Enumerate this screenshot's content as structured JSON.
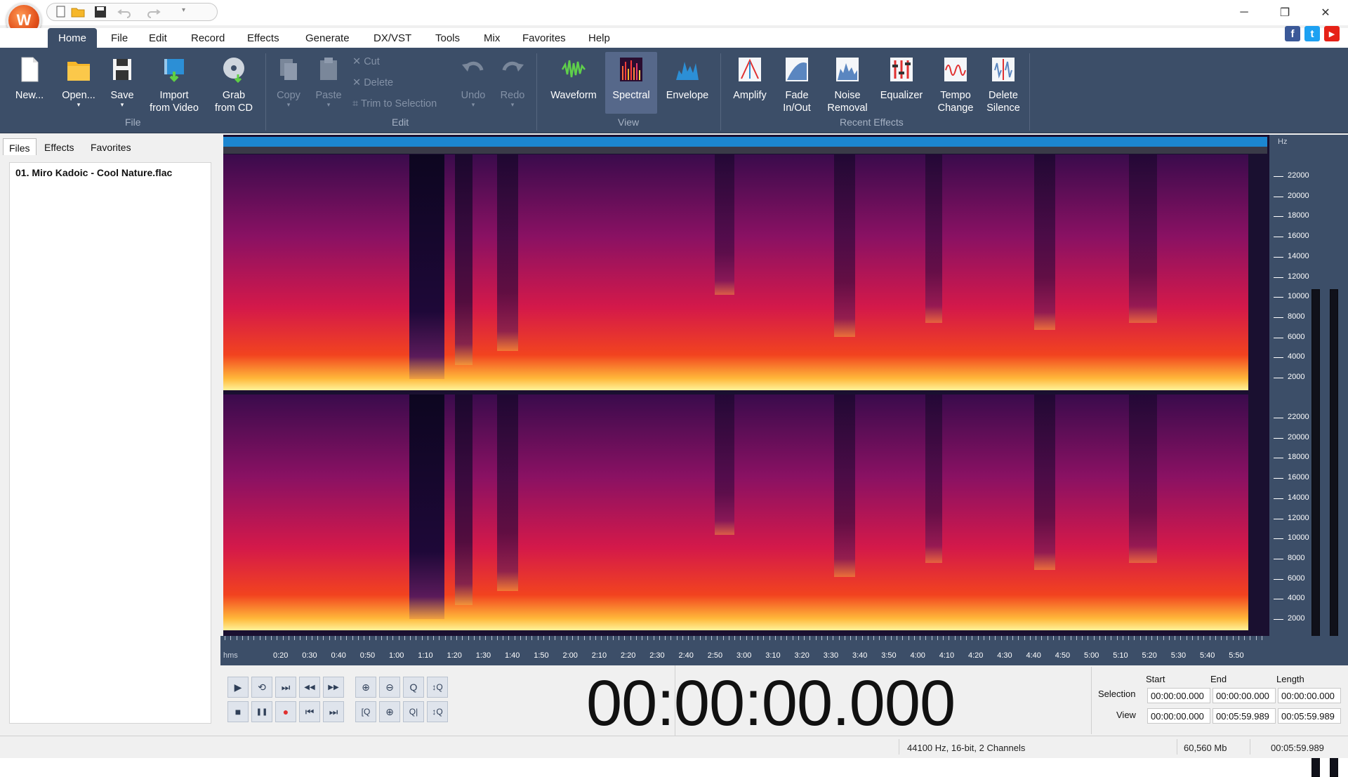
{
  "app": {
    "logo_letter": "W",
    "window_controls": {
      "minimize": "─",
      "restore": "❐",
      "close": "✕"
    },
    "social": {
      "facebook": "f",
      "twitter": "t",
      "youtube": "▶"
    }
  },
  "menu": {
    "items": [
      "Home",
      "File",
      "Edit",
      "Record",
      "Effects",
      "Generate",
      "DX/VST",
      "Tools",
      "Mix",
      "Favorites",
      "Help"
    ],
    "active": "Home"
  },
  "ribbon": {
    "file": {
      "new": "New...",
      "open": "Open...",
      "save": "Save",
      "import_line1": "Import",
      "import_line2": "from Video",
      "grab_line1": "Grab",
      "grab_line2": "from CD",
      "group": "File"
    },
    "edit": {
      "copy": "Copy",
      "paste": "Paste",
      "cut": "Cut",
      "delete": "Delete",
      "trim": "Trim to Selection",
      "undo": "Undo",
      "redo": "Redo",
      "group": "Edit"
    },
    "view": {
      "waveform": "Waveform",
      "spectral": "Spectral",
      "envelope": "Envelope",
      "group": "View"
    },
    "recent": {
      "amplify": "Amplify",
      "fade_line1": "Fade",
      "fade_line2": "In/Out",
      "noise_line1": "Noise",
      "noise_line2": "Removal",
      "equalizer": "Equalizer",
      "tempo_line1": "Tempo",
      "tempo_line2": "Change",
      "silence_line1": "Delete",
      "silence_line2": "Silence",
      "group": "Recent Effects"
    },
    "dropdown_arrow": "▾"
  },
  "left_panel": {
    "tabs": [
      "Files",
      "Effects",
      "Favorites"
    ],
    "active_tab": "Files",
    "files": [
      "01. Miro Kadoic - Cool Nature.flac"
    ]
  },
  "freq_axis": {
    "unit": "Hz",
    "ticks": [
      "22000",
      "20000",
      "18000",
      "16000",
      "14000",
      "12000",
      "10000",
      "8000",
      "6000",
      "4000",
      "2000"
    ]
  },
  "time_axis": {
    "unit": "hms",
    "ticks": [
      "0:20",
      "0:30",
      "0:40",
      "0:50",
      "1:00",
      "1:10",
      "1:20",
      "1:30",
      "1:40",
      "1:50",
      "2:00",
      "2:10",
      "2:20",
      "2:30",
      "2:40",
      "2:50",
      "3:00",
      "3:10",
      "3:20",
      "3:30",
      "3:40",
      "3:50",
      "4:00",
      "4:10",
      "4:20",
      "4:30",
      "4:40",
      "4:50",
      "5:00",
      "5:10",
      "5:20",
      "5:30",
      "5:40",
      "5:50"
    ]
  },
  "transport": {
    "play": "▶",
    "loop": "⟲",
    "to_end": "⏭",
    "rewind": "◀◀",
    "forward": "▶▶",
    "stop": "■",
    "pause": "❚❚",
    "record": "●",
    "prev": "⏮",
    "next": "⏭",
    "zoom_in": "⊕",
    "zoom_out": "⊖",
    "zoom_sel": "Q",
    "zoom_v": "↕Q",
    "zoom_full": "[Q",
    "zoom_in2": "⊕",
    "zoom_out2": "Q|",
    "zoom_v2": "↕Q"
  },
  "time_display": "00:00:00.000",
  "selection": {
    "headers": {
      "start": "Start",
      "end": "End",
      "length": "Length"
    },
    "rows": [
      {
        "label": "Selection",
        "start": "00:00:00.000",
        "end": "00:00:00.000",
        "length": "00:00:00.000"
      },
      {
        "label": "View",
        "start": "00:00:00.000",
        "end": "00:05:59.989",
        "length": "00:05:59.989"
      }
    ]
  },
  "status": {
    "format": "44100 Hz, 16-bit, 2 Channels",
    "memory": "60,560 Mb",
    "duration": "00:05:59.989"
  }
}
